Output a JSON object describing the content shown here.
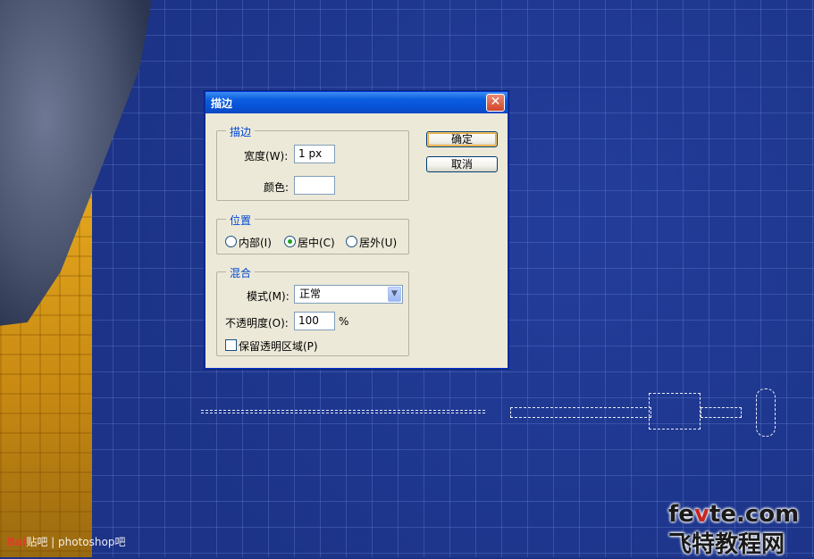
{
  "dialog": {
    "title": "描边",
    "close_glyph": "✕",
    "stroke_group": {
      "legend": "描边",
      "width_label": "宽度(W):",
      "width_value": "1 px",
      "color_label": "颜色:",
      "color_value": "#ffffff"
    },
    "position_group": {
      "legend": "位置",
      "options": [
        "内部(I)",
        "居中(C)",
        "居外(U)"
      ],
      "selected": "居中(C)"
    },
    "blend_group": {
      "legend": "混合",
      "mode_label": "模式(M):",
      "mode_value": "正常",
      "opacity_label": "不透明度(O):",
      "opacity_value": "100",
      "opacity_unit": "%",
      "preserve_label": "保留透明区域(P)",
      "preserve_checked": false
    },
    "ok_label": "确定",
    "cancel_label": "取消"
  },
  "watermarks": {
    "left_brand": "Bai",
    "left_text": "贴吧 | photoshop吧",
    "right_top_a": "fe",
    "right_top_b": "v",
    "right_top_c": "te.com",
    "right_bottom": "飞特教程网"
  },
  "colors": {
    "canvas_blue": "#1c3387",
    "title_bar": "#0852d6",
    "dialog_face": "#ece9d8",
    "legend_text": "#0046d5"
  }
}
